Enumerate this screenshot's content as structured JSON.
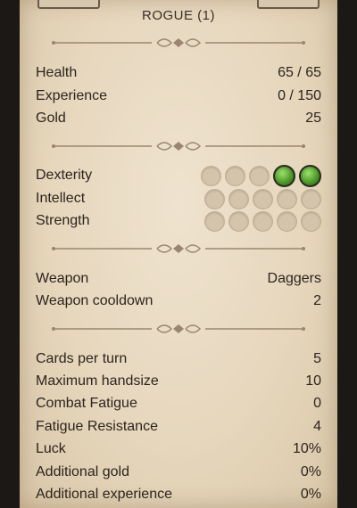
{
  "title": "ROGUE (1)",
  "stats_basic": [
    {
      "label": "Health",
      "value": "65 / 65"
    },
    {
      "label": "Experience",
      "value": "0 / 150"
    },
    {
      "label": "Gold",
      "value": "25"
    }
  ],
  "attributes": [
    {
      "label": "Dexterity",
      "points": 2,
      "max": 5
    },
    {
      "label": "Intellect",
      "points": 0,
      "max": 5
    },
    {
      "label": "Strength",
      "points": 0,
      "max": 5
    }
  ],
  "weapon": [
    {
      "label": "Weapon",
      "value": "Daggers"
    },
    {
      "label": "Weapon cooldown",
      "value": "2"
    }
  ],
  "misc": [
    {
      "label": "Cards per turn",
      "value": "5"
    },
    {
      "label": "Maximum handsize",
      "value": "10"
    },
    {
      "label": "Combat Fatigue",
      "value": "0"
    },
    {
      "label": "Fatigue Resistance",
      "value": "4"
    },
    {
      "label": "Luck",
      "value": "10%"
    },
    {
      "label": "Additional gold",
      "value": "0%"
    },
    {
      "label": "Additional experience",
      "value": "0%"
    }
  ],
  "colors": {
    "parchment": "#e9dcc4",
    "text": "#2c241d",
    "attribute_filled": "#4f9a2b"
  },
  "icons": [
    "ornamental-divider-icon"
  ]
}
